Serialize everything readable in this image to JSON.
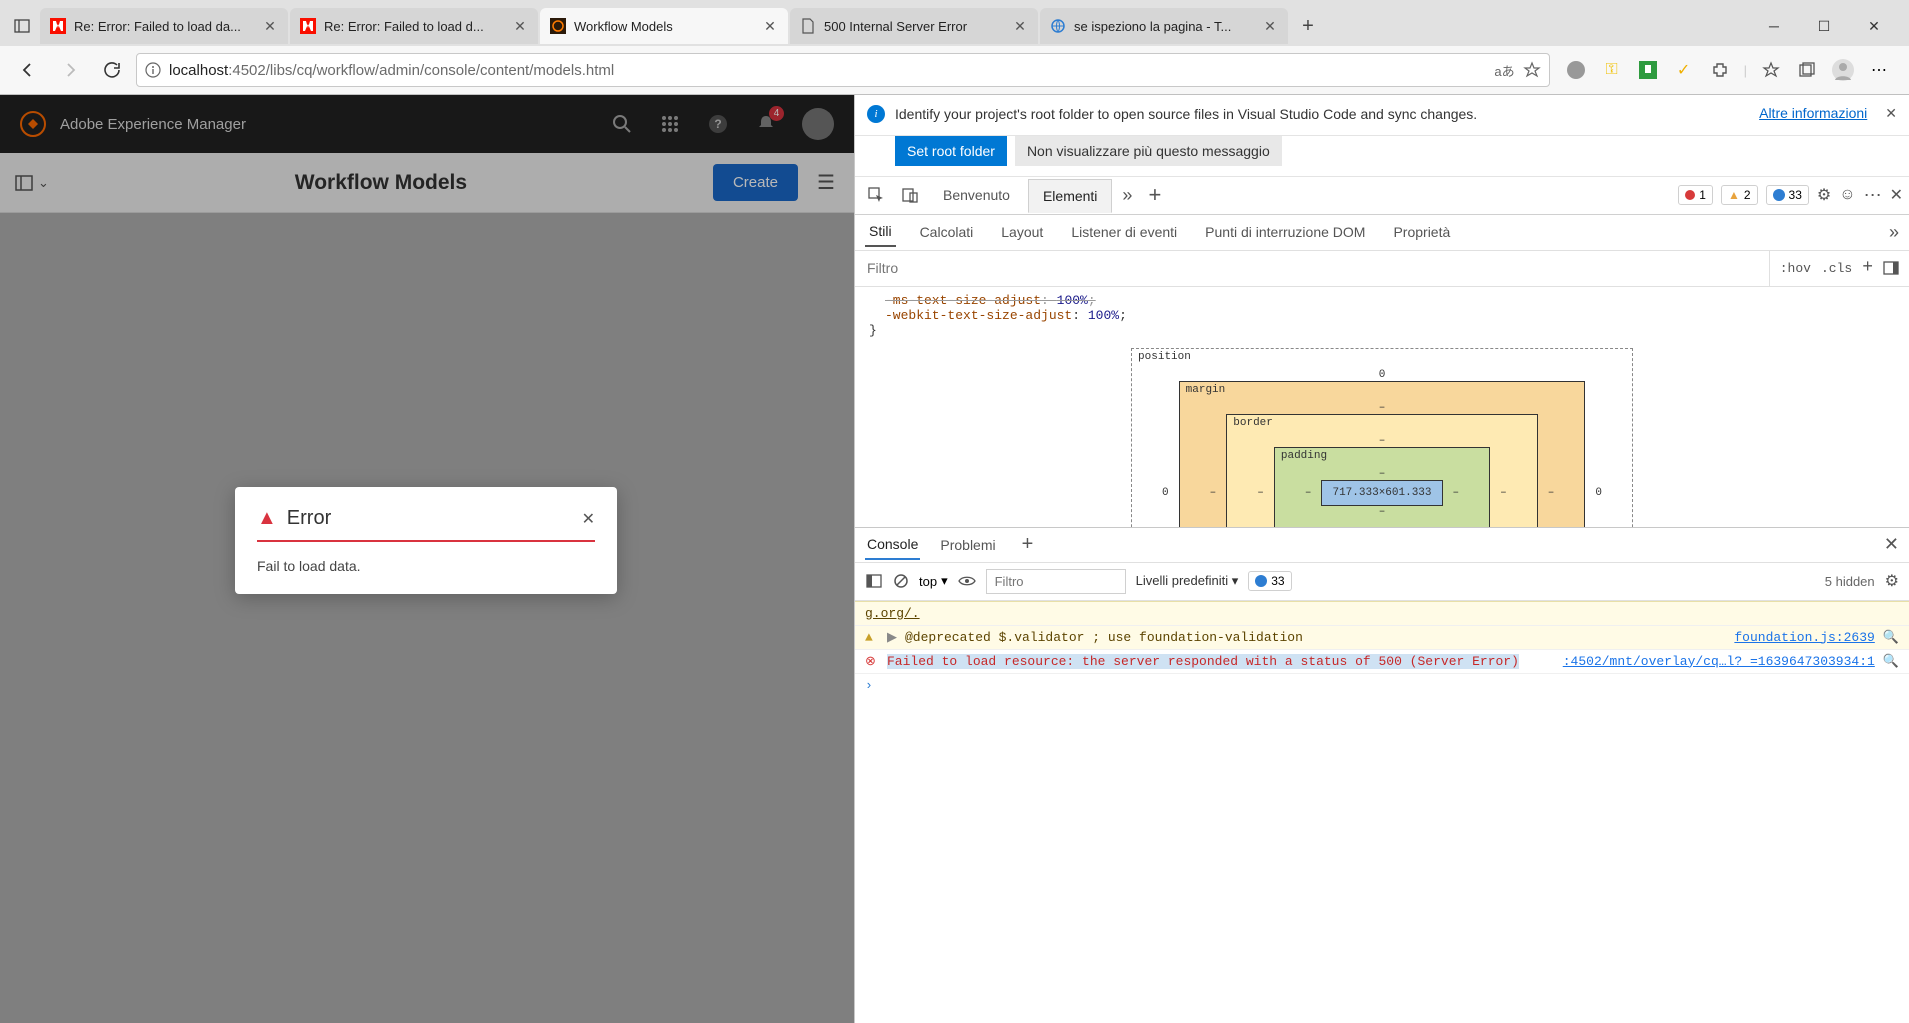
{
  "browser": {
    "tabs": [
      {
        "title": "Re: Error: Failed to load da...",
        "favicon": "adobe"
      },
      {
        "title": "Re: Error: Failed to load d...",
        "favicon": "adobe"
      },
      {
        "title": "Workflow Models",
        "favicon": "aem",
        "active": true
      },
      {
        "title": "500 Internal Server Error",
        "favicon": "doc"
      },
      {
        "title": "se ispeziono la pagina - T...",
        "favicon": "globe"
      }
    ],
    "url_host": "localhost",
    "url_path": ":4502/libs/cq/workflow/admin/console/content/models.html"
  },
  "aem": {
    "brand": "Adobe Experience Manager",
    "notif_count": "4",
    "page_title": "Workflow Models",
    "create_label": "Create",
    "modal": {
      "title": "Error",
      "body": "Fail to load data."
    }
  },
  "devtools": {
    "info_text": "Identify your project's root folder to open source files in Visual Studio Code and sync changes.",
    "info_link": "Altre informazioni",
    "btn_set_root": "Set root folder",
    "btn_dismiss": "Non visualizzare più questo messaggio",
    "tabs": {
      "welcome": "Benvenuto",
      "elements": "Elementi"
    },
    "counts": {
      "errors": "1",
      "warnings": "2",
      "info": "33"
    },
    "subtabs": {
      "styles": "Stili",
      "computed": "Calcolati",
      "layout": "Layout",
      "listeners": "Listener di eventi",
      "breakpoints": "Punti di interruzione DOM",
      "properties": "Proprietà"
    },
    "filter_placeholder": "Filtro",
    "filter_tools": {
      "hov": ":hov",
      "cls": ".cls"
    },
    "styles_css": {
      "line1_prop": "-ms-text-size-adjust",
      "line1_val": "100%",
      "line2_prop": "-webkit-text-size-adjust",
      "line2_val": "100%"
    },
    "box_model": {
      "position": "position",
      "pos_top": "0",
      "pos_side": "0",
      "margin": "margin",
      "border": "border",
      "padding": "padding",
      "dash": "–",
      "content": "717.333×601.333"
    },
    "console": {
      "tab_console": "Console",
      "tab_problems": "Problemi",
      "context": "top",
      "filter_placeholder": "Filtro",
      "levels": "Livelli predefiniti",
      "info_count": "33",
      "hidden": "5 hidden",
      "logs": [
        {
          "type": "warn",
          "arrow": "▶",
          "msg": "@deprecated  $.validator ; use foundation-validation",
          "src": "foundation.js:2639"
        },
        {
          "type": "err",
          "msg": "Failed to load resource: the server responded with a status of 500 (Server Error)",
          "src": ":4502/mnt/overlay/cq…l?_=1639647303934:1"
        }
      ],
      "gorg": "g.org/."
    }
  }
}
